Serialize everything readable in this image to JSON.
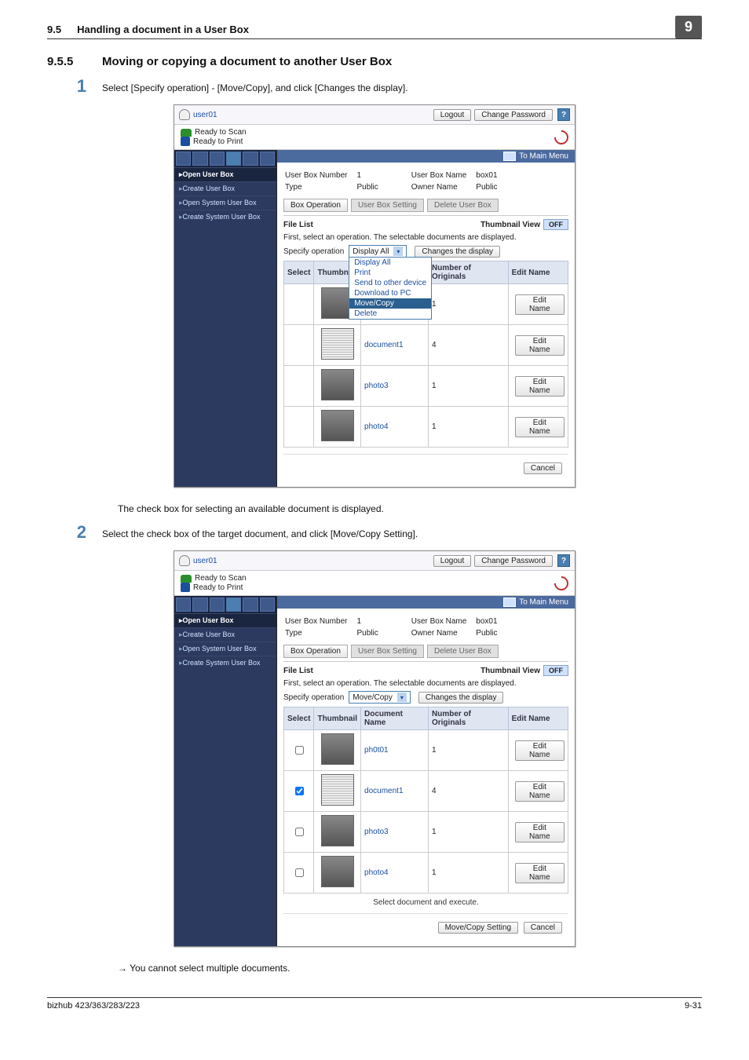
{
  "header": {
    "section_number": "9.5",
    "section_title": "Handling a document in a User Box",
    "chapter": "9"
  },
  "subsection": {
    "number": "9.5.5",
    "title": "Moving or copying a document to another User Box"
  },
  "step1": {
    "number": "1",
    "text": "Select [Specify operation] - [Move/Copy], and click [Changes the display]."
  },
  "caption1": "The check box for selecting an available document is displayed.",
  "step2": {
    "number": "2",
    "text": "Select the check box of the target document, and click [Move/Copy Setting]."
  },
  "note1": "You cannot select multiple documents.",
  "topbar": {
    "user": "user01",
    "logout": "Logout",
    "change_password": "Change Password",
    "scan": "Ready to Scan",
    "print": "Ready to Print",
    "to_main_menu": "To Main Menu"
  },
  "side": {
    "open_user_box": "Open User Box",
    "create_user_box": "Create User Box",
    "open_system_user_box": "Open System User Box",
    "create_system_user_box": "Create System User Box"
  },
  "info": {
    "ubn_lbl": "User Box Number",
    "ubn_val": "1",
    "ubm_lbl": "User Box Name",
    "ubm_val": "box01",
    "type_lbl": "Type",
    "type_val": "Public",
    "owner_lbl": "Owner Name",
    "owner_val": "Public"
  },
  "tabs": {
    "op": "Box Operation",
    "setting": "User Box Setting",
    "delete": "Delete User Box"
  },
  "filelist": {
    "title": "File List",
    "thumb_view": "Thumbnail View",
    "off": "OFF",
    "first_line": "First, select an operation. The selectable documents are displayed.",
    "specify": "Specify operation",
    "changes": "Changes the display",
    "sel": "Select",
    "thumb": "Thumbnail",
    "docname": "Document Name",
    "num": "Number of Originals",
    "edit": "Edit Name",
    "edit_btn": "Edit Name",
    "cancel": "Cancel",
    "sel_exec": "Select document and execute.",
    "mc_setting": "Move/Copy Setting"
  },
  "dropdown1": {
    "selected": "Display All",
    "options": [
      "Display All",
      "Print",
      "Send to other device",
      "Download to PC",
      "Move/Copy",
      "Delete"
    ]
  },
  "dropdown2": {
    "selected": "Move/Copy"
  },
  "rows": [
    {
      "name": "ph0t01",
      "num": "1"
    },
    {
      "name": "document1",
      "num": "4"
    },
    {
      "name": "photo3",
      "num": "1"
    },
    {
      "name": "photo4",
      "num": "1"
    }
  ],
  "footer": {
    "model": "bizhub 423/363/283/223",
    "page": "9-31"
  }
}
